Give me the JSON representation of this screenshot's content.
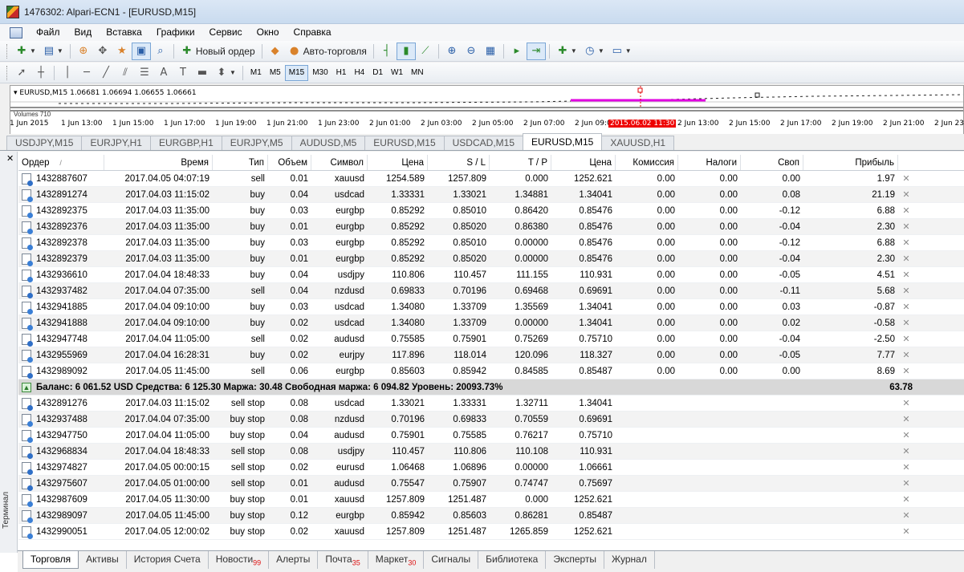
{
  "window": {
    "title": "1476302: Alpari-ECN1 - [EURUSD,M15]"
  },
  "menu": [
    "Файл",
    "Вид",
    "Вставка",
    "Графики",
    "Сервис",
    "Окно",
    "Справка"
  ],
  "toolbar": {
    "new_order_label": "Новый ордер",
    "autotrading_label": "Авто-торговля",
    "timeframes": [
      "M1",
      "M5",
      "M15",
      "M30",
      "H1",
      "H4",
      "D1",
      "W1",
      "MN"
    ],
    "active_timeframe": "M15"
  },
  "chart": {
    "info": "EURUSD,M15  1.06681 1.06694 1.06655 1.06661",
    "volume_label": "Volumes 710",
    "time_ticks": [
      "1 Jun 2015",
      "1 Jun 13:00",
      "1 Jun 15:00",
      "1 Jun 17:00",
      "1 Jun 19:00",
      "1 Jun 21:00",
      "1 Jun 23:00",
      "2 Jun 01:00",
      "2 Jun 03:00",
      "2 Jun 05:00",
      "2 Jun 07:00",
      "2 Jun 09:0",
      "2015.06.02 11:30",
      "2 Jun 13:00",
      "2 Jun 15:00",
      "2 Jun 17:00",
      "2 Jun 19:00",
      "2 Jun 21:00",
      "2 Jun 23:"
    ],
    "highlight_tick": "2015.06.02 11:30",
    "highlight_color": "#e00000",
    "line_color": "#e000e0"
  },
  "chart_tabs": [
    "USDJPY,M15",
    "EURJPY,H1",
    "EURGBP,H1",
    "EURJPY,M5",
    "AUDUSD,M5",
    "EURUSD,M15",
    "USDCAD,M15",
    "EURUSD,M15",
    "XAUUSD,H1"
  ],
  "active_chart_tab_index": 7,
  "terminal": {
    "side_label": "Терминал",
    "columns": {
      "order": "Ордер",
      "time": "Время",
      "type": "Тип",
      "volume": "Объем",
      "symbol": "Символ",
      "price": "Цена",
      "sl": "S / L",
      "tp": "T / P",
      "current": "Цена",
      "commission": "Комиссия",
      "taxes": "Налоги",
      "swap": "Своп",
      "profit": "Прибыль"
    },
    "sort_indicator": "/",
    "positions": [
      {
        "order": "1432887607",
        "time": "2017.04.05 04:07:19",
        "type": "sell",
        "volume": "0.01",
        "symbol": "xauusd",
        "price": "1254.589",
        "sl": "1257.809",
        "tp": "0.000",
        "current": "1252.621",
        "commission": "0.00",
        "taxes": "0.00",
        "swap": "0.00",
        "profit": "1.97"
      },
      {
        "order": "1432891274",
        "time": "2017.04.03 11:15:02",
        "type": "buy",
        "volume": "0.04",
        "symbol": "usdcad",
        "price": "1.33331",
        "sl": "1.33021",
        "tp": "1.34881",
        "current": "1.34041",
        "commission": "0.00",
        "taxes": "0.00",
        "swap": "0.08",
        "profit": "21.19"
      },
      {
        "order": "1432892375",
        "time": "2017.04.03 11:35:00",
        "type": "buy",
        "volume": "0.03",
        "symbol": "eurgbp",
        "price": "0.85292",
        "sl": "0.85010",
        "tp": "0.86420",
        "current": "0.85476",
        "commission": "0.00",
        "taxes": "0.00",
        "swap": "-0.12",
        "profit": "6.88"
      },
      {
        "order": "1432892376",
        "time": "2017.04.03 11:35:00",
        "type": "buy",
        "volume": "0.01",
        "symbol": "eurgbp",
        "price": "0.85292",
        "sl": "0.85020",
        "tp": "0.86380",
        "current": "0.85476",
        "commission": "0.00",
        "taxes": "0.00",
        "swap": "-0.04",
        "profit": "2.30"
      },
      {
        "order": "1432892378",
        "time": "2017.04.03 11:35:00",
        "type": "buy",
        "volume": "0.03",
        "symbol": "eurgbp",
        "price": "0.85292",
        "sl": "0.85010",
        "tp": "0.00000",
        "current": "0.85476",
        "commission": "0.00",
        "taxes": "0.00",
        "swap": "-0.12",
        "profit": "6.88"
      },
      {
        "order": "1432892379",
        "time": "2017.04.03 11:35:00",
        "type": "buy",
        "volume": "0.01",
        "symbol": "eurgbp",
        "price": "0.85292",
        "sl": "0.85020",
        "tp": "0.00000",
        "current": "0.85476",
        "commission": "0.00",
        "taxes": "0.00",
        "swap": "-0.04",
        "profit": "2.30"
      },
      {
        "order": "1432936610",
        "time": "2017.04.04 18:48:33",
        "type": "buy",
        "volume": "0.04",
        "symbol": "usdjpy",
        "price": "110.806",
        "sl": "110.457",
        "tp": "111.155",
        "current": "110.931",
        "commission": "0.00",
        "taxes": "0.00",
        "swap": "-0.05",
        "profit": "4.51"
      },
      {
        "order": "1432937482",
        "time": "2017.04.04 07:35:00",
        "type": "sell",
        "volume": "0.04",
        "symbol": "nzdusd",
        "price": "0.69833",
        "sl": "0.70196",
        "tp": "0.69468",
        "current": "0.69691",
        "commission": "0.00",
        "taxes": "0.00",
        "swap": "-0.11",
        "profit": "5.68"
      },
      {
        "order": "1432941885",
        "time": "2017.04.04 09:10:00",
        "type": "buy",
        "volume": "0.03",
        "symbol": "usdcad",
        "price": "1.34080",
        "sl": "1.33709",
        "tp": "1.35569",
        "current": "1.34041",
        "commission": "0.00",
        "taxes": "0.00",
        "swap": "0.03",
        "profit": "-0.87"
      },
      {
        "order": "1432941888",
        "time": "2017.04.04 09:10:00",
        "type": "buy",
        "volume": "0.02",
        "symbol": "usdcad",
        "price": "1.34080",
        "sl": "1.33709",
        "tp": "0.00000",
        "current": "1.34041",
        "commission": "0.00",
        "taxes": "0.00",
        "swap": "0.02",
        "profit": "-0.58"
      },
      {
        "order": "1432947748",
        "time": "2017.04.04 11:05:00",
        "type": "sell",
        "volume": "0.02",
        "symbol": "audusd",
        "price": "0.75585",
        "sl": "0.75901",
        "tp": "0.75269",
        "current": "0.75710",
        "commission": "0.00",
        "taxes": "0.00",
        "swap": "-0.04",
        "profit": "-2.50"
      },
      {
        "order": "1432955969",
        "time": "2017.04.04 16:28:31",
        "type": "buy",
        "volume": "0.02",
        "symbol": "eurjpy",
        "price": "117.896",
        "sl": "118.014",
        "tp": "120.096",
        "current": "118.327",
        "commission": "0.00",
        "taxes": "0.00",
        "swap": "-0.05",
        "profit": "7.77"
      },
      {
        "order": "1432989092",
        "time": "2017.04.05 11:45:00",
        "type": "sell",
        "volume": "0.06",
        "symbol": "eurgbp",
        "price": "0.85603",
        "sl": "0.85942",
        "tp": "0.84585",
        "current": "0.85487",
        "commission": "0.00",
        "taxes": "0.00",
        "swap": "0.00",
        "profit": "8.69"
      }
    ],
    "balance": {
      "text": "Баланс: 6 061.52 USD  Средства: 6 125.30  Маржа: 30.48  Свободная маржа: 6 094.82  Уровень: 20093.73%",
      "profit": "63.78"
    },
    "pending": [
      {
        "order": "1432891276",
        "time": "2017.04.03 11:15:02",
        "type": "sell stop",
        "volume": "0.08",
        "symbol": "usdcad",
        "price": "1.33021",
        "sl": "1.33331",
        "tp": "1.32711",
        "current": "1.34041"
      },
      {
        "order": "1432937488",
        "time": "2017.04.04 07:35:00",
        "type": "buy stop",
        "volume": "0.08",
        "symbol": "nzdusd",
        "price": "0.70196",
        "sl": "0.69833",
        "tp": "0.70559",
        "current": "0.69691"
      },
      {
        "order": "1432947750",
        "time": "2017.04.04 11:05:00",
        "type": "buy stop",
        "volume": "0.04",
        "symbol": "audusd",
        "price": "0.75901",
        "sl": "0.75585",
        "tp": "0.76217",
        "current": "0.75710"
      },
      {
        "order": "1432968834",
        "time": "2017.04.04 18:48:33",
        "type": "sell stop",
        "volume": "0.08",
        "symbol": "usdjpy",
        "price": "110.457",
        "sl": "110.806",
        "tp": "110.108",
        "current": "110.931"
      },
      {
        "order": "1432974827",
        "time": "2017.04.05 00:00:15",
        "type": "sell stop",
        "volume": "0.02",
        "symbol": "eurusd",
        "price": "1.06468",
        "sl": "1.06896",
        "tp": "0.00000",
        "current": "1.06661"
      },
      {
        "order": "1432975607",
        "time": "2017.04.05 01:00:00",
        "type": "sell stop",
        "volume": "0.01",
        "symbol": "audusd",
        "price": "0.75547",
        "sl": "0.75907",
        "tp": "0.74747",
        "current": "0.75697"
      },
      {
        "order": "1432987609",
        "time": "2017.04.05 11:30:00",
        "type": "buy stop",
        "volume": "0.01",
        "symbol": "xauusd",
        "price": "1257.809",
        "sl": "1251.487",
        "tp": "0.000",
        "current": "1252.621"
      },
      {
        "order": "1432989097",
        "time": "2017.04.05 11:45:00",
        "type": "buy stop",
        "volume": "0.12",
        "symbol": "eurgbp",
        "price": "0.85942",
        "sl": "0.85603",
        "tp": "0.86281",
        "current": "0.85487"
      },
      {
        "order": "1432990051",
        "time": "2017.04.05 12:00:02",
        "type": "buy stop",
        "volume": "0.02",
        "symbol": "xauusd",
        "price": "1257.809",
        "sl": "1251.487",
        "tp": "1265.859",
        "current": "1252.621"
      }
    ]
  },
  "bottom_tabs": [
    {
      "label": "Торговля",
      "count": ""
    },
    {
      "label": "Активы",
      "count": ""
    },
    {
      "label": "История Счета",
      "count": ""
    },
    {
      "label": "Новости",
      "count": "99"
    },
    {
      "label": "Алерты",
      "count": ""
    },
    {
      "label": "Почта",
      "count": "35"
    },
    {
      "label": "Маркет",
      "count": "30"
    },
    {
      "label": "Сигналы",
      "count": ""
    },
    {
      "label": "Библиотека",
      "count": ""
    },
    {
      "label": "Эксперты",
      "count": ""
    },
    {
      "label": "Журнал",
      "count": ""
    }
  ],
  "active_bottom_tab_index": 0
}
